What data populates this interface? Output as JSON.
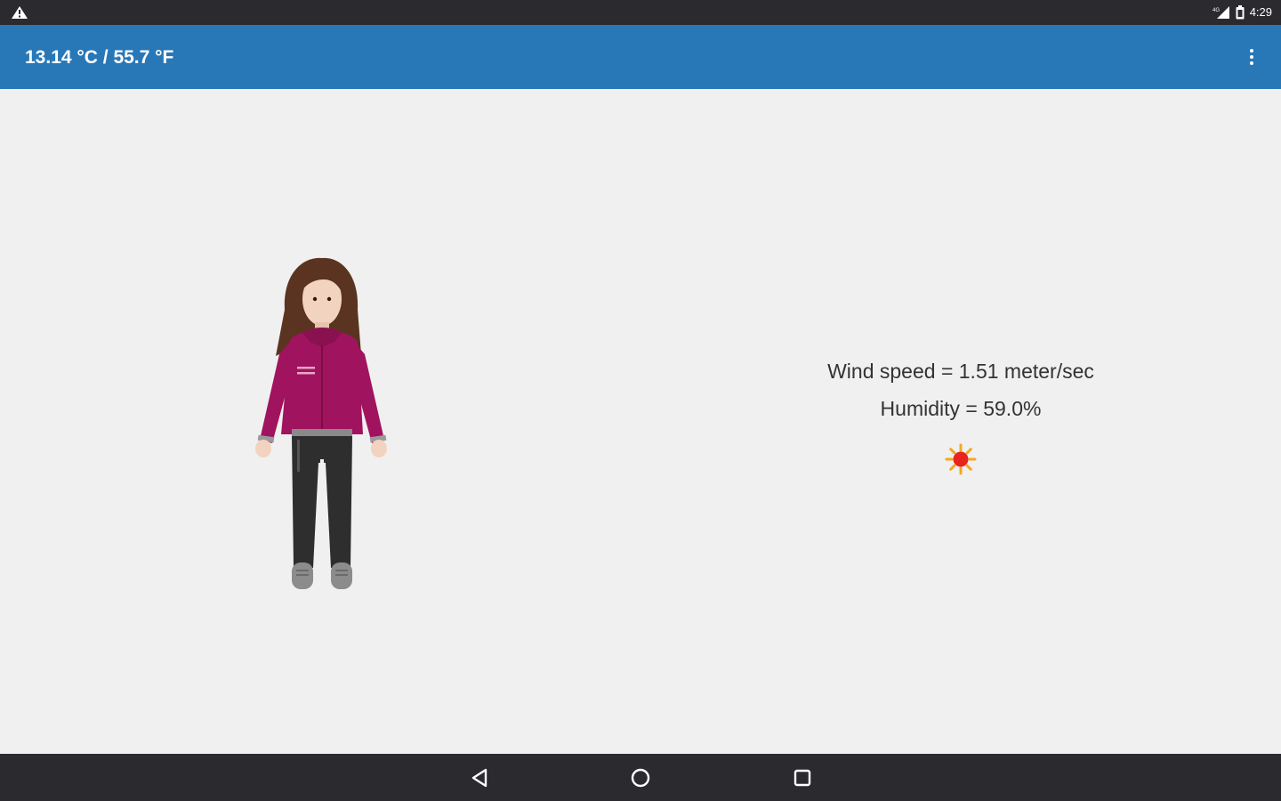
{
  "status_bar": {
    "time": "4:29",
    "icons": [
      "warning-icon",
      "signal-icon",
      "battery-icon"
    ]
  },
  "app_bar": {
    "title": "13.14 °C / 55.7 °F",
    "menu_icon": "overflow-menu-icon"
  },
  "weather": {
    "wind_speed": "Wind speed = 1.51 meter/sec",
    "humidity": "Humidity = 59.0%",
    "condition_icon": "sun-icon"
  },
  "avatar": {
    "icon": "person-icon",
    "colors": {
      "jacket": "#a0135e",
      "pants": "#2e2e2e",
      "hair": "#5a3420",
      "skin": "#f2d3c0"
    }
  },
  "nav_bar": {
    "buttons": [
      "back-icon",
      "home-icon",
      "recents-icon"
    ]
  },
  "colors": {
    "app_bar": "#2878b8",
    "status_bar": "#2b2b2f",
    "background": "#f0f0f0"
  }
}
